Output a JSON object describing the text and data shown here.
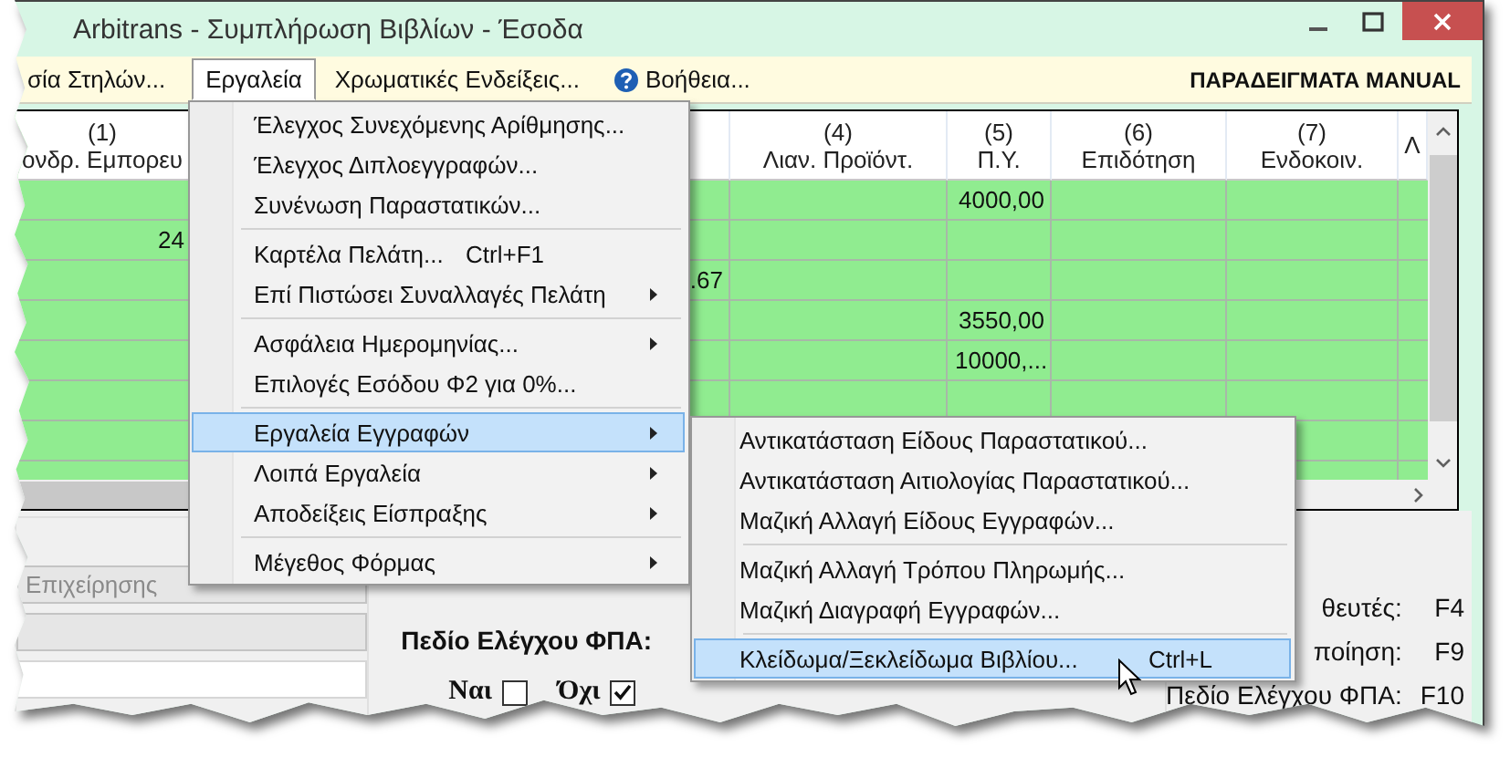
{
  "window": {
    "title": "Arbitrans - Συμπλήρωση Βιβλίων - Έσοδα"
  },
  "menu_bar": {
    "items": [
      {
        "label": "σία Στηλών...",
        "kind": "plain",
        "selected": false
      },
      {
        "label": "Εργαλεία",
        "kind": "plain",
        "selected": true
      },
      {
        "label": "Χρωματικές Ενδείξεις...",
        "kind": "plain",
        "selected": false
      },
      {
        "label": "Βοήθεια...",
        "kind": "help",
        "selected": false
      }
    ],
    "right_label": "ΠΑΡΑΔΕΙΓΜΑΤΑ MANUAL"
  },
  "table": {
    "columns": [
      {
        "number": "(1)",
        "label": "ονδρ. Εμπορευ"
      },
      {},
      {
        "number": "(4)",
        "label": "Λιαν. Προϊόντ."
      },
      {
        "number": "(5)",
        "label": "Π.Υ."
      },
      {
        "number": "(6)",
        "label": "Επιδότηση"
      },
      {
        "number": "(7)",
        "label": "Ενδοκοιν."
      },
      {
        "label": "Λ"
      }
    ],
    "rows": [
      {
        "cells": [
          null,
          null,
          null,
          "4000,00",
          null,
          null,
          null
        ]
      },
      {
        "cells": [
          "24",
          null,
          null,
          null,
          null,
          null,
          null
        ]
      },
      {
        "cells": [
          null,
          ".67",
          null,
          null,
          null,
          null,
          null
        ]
      },
      {
        "cells": [
          null,
          null,
          null,
          "3550,00",
          null,
          null,
          null
        ]
      },
      {
        "cells": [
          null,
          null,
          null,
          "10000,...",
          null,
          null,
          null
        ]
      },
      {
        "cells": [
          null,
          null,
          null,
          null,
          null,
          null,
          null
        ]
      },
      {
        "cells": [
          null,
          null,
          null,
          null,
          null,
          null,
          null
        ]
      },
      {
        "cells": [
          null,
          null,
          null,
          null,
          null,
          null,
          null
        ]
      }
    ]
  },
  "menu": {
    "items": [
      {
        "kind": "item",
        "label": "Έλεγχος Συνεχόμενης Αρίθμησης...",
        "has_submenu": false,
        "selected": false
      },
      {
        "kind": "item",
        "label": "Έλεγχος Διπλοεγγραφών...",
        "has_submenu": false,
        "selected": false
      },
      {
        "kind": "item",
        "label": "Συνένωση Παραστατικών...",
        "has_submenu": false,
        "selected": false
      },
      {
        "kind": "separator"
      },
      {
        "kind": "item",
        "label": "Καρτέλα Πελάτη...",
        "shortcut": "Ctrl+F1",
        "has_submenu": false,
        "selected": false
      },
      {
        "kind": "item",
        "label": "Επί Πιστώσει Συναλλαγές Πελάτη",
        "has_submenu": true,
        "selected": false
      },
      {
        "kind": "separator"
      },
      {
        "kind": "item",
        "label": "Ασφάλεια Ημερομηνίας...",
        "has_submenu": true,
        "selected": false
      },
      {
        "kind": "item",
        "label": "Επιλογές Εσόδου Φ2 για 0%...",
        "has_submenu": false,
        "selected": false
      },
      {
        "kind": "separator"
      },
      {
        "kind": "item",
        "label": "Εργαλεία Εγγραφών",
        "has_submenu": true,
        "selected": true
      },
      {
        "kind": "item",
        "label": "Λοιπά Εργαλεία",
        "has_submenu": true,
        "selected": false
      },
      {
        "kind": "item",
        "label": "Αποδείξεις Είσπραξης",
        "has_submenu": true,
        "selected": false
      },
      {
        "kind": "separator"
      },
      {
        "kind": "item",
        "label": "Μέγεθος Φόρμας",
        "has_submenu": true,
        "selected": false
      }
    ]
  },
  "submenu": {
    "items": [
      {
        "kind": "item",
        "label": "Αντικατάσταση Είδους Παραστατικού...",
        "has_submenu": false,
        "selected": false
      },
      {
        "kind": "item",
        "label": "Αντικατάσταση Αιτιολογίας Παραστατικού...",
        "has_submenu": false,
        "selected": false
      },
      {
        "kind": "item",
        "label": "Μαζική Αλλαγή Είδους Εγγραφών...",
        "has_submenu": false,
        "selected": false
      },
      {
        "kind": "separator"
      },
      {
        "kind": "item",
        "label": "Μαζική Αλλαγή Τρόπου Πληρωμής...",
        "has_submenu": false,
        "selected": false
      },
      {
        "kind": "item",
        "label": "Μαζική Διαγραφή Εγγραφών...",
        "has_submenu": false,
        "selected": false
      },
      {
        "kind": "separator"
      },
      {
        "kind": "item",
        "label": "Κλείδωμα/Ξεκλείδωμα Βιβλίου...",
        "shortcut": "Ctrl+L",
        "has_submenu": false,
        "selected": true
      }
    ]
  },
  "fields": [
    {
      "value": "Επιχείρησης",
      "disabled": true
    },
    {
      "disabled": true
    },
    {
      "disabled": false
    }
  ],
  "vat_check": {
    "label": "Πεδίο Ελέγχου ΦΠΑ:",
    "options": [
      {
        "label": "Ναι",
        "checked": false
      },
      {
        "label": "Όχι",
        "checked": true
      }
    ]
  },
  "shortcuts": [
    {
      "label": "θευτές:",
      "key": "F4"
    },
    {
      "label": "ποίηση:",
      "key": "F9"
    },
    {
      "label": "Πεδίο Ελέγχου ΦΠΑ:",
      "key": "F10"
    }
  ]
}
